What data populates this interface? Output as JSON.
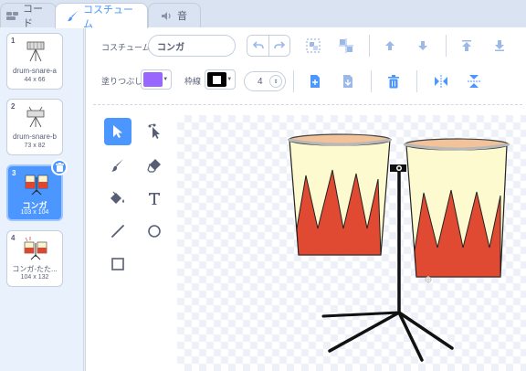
{
  "tabs": {
    "code": "コード",
    "costume": "コスチューム",
    "sound": "音"
  },
  "costumes": [
    {
      "num": "1",
      "name": "drum-snare-a",
      "size": "44 x 66"
    },
    {
      "num": "2",
      "name": "drum-snare-b",
      "size": "73 x 82"
    },
    {
      "num": "3",
      "name": "コンガ",
      "size": "103 x 104"
    },
    {
      "num": "4",
      "name": "コンガ-たた...",
      "size": "104 x 132"
    }
  ],
  "editor": {
    "costume_label": "コスチューム",
    "costume_name": "コンガ",
    "fill_label": "塗りつぶし",
    "outline_label": "枠線",
    "outline_width": "4"
  },
  "colors": {
    "accent": "#4c97ff",
    "fill": "#9966ff",
    "outline": "#000000"
  }
}
